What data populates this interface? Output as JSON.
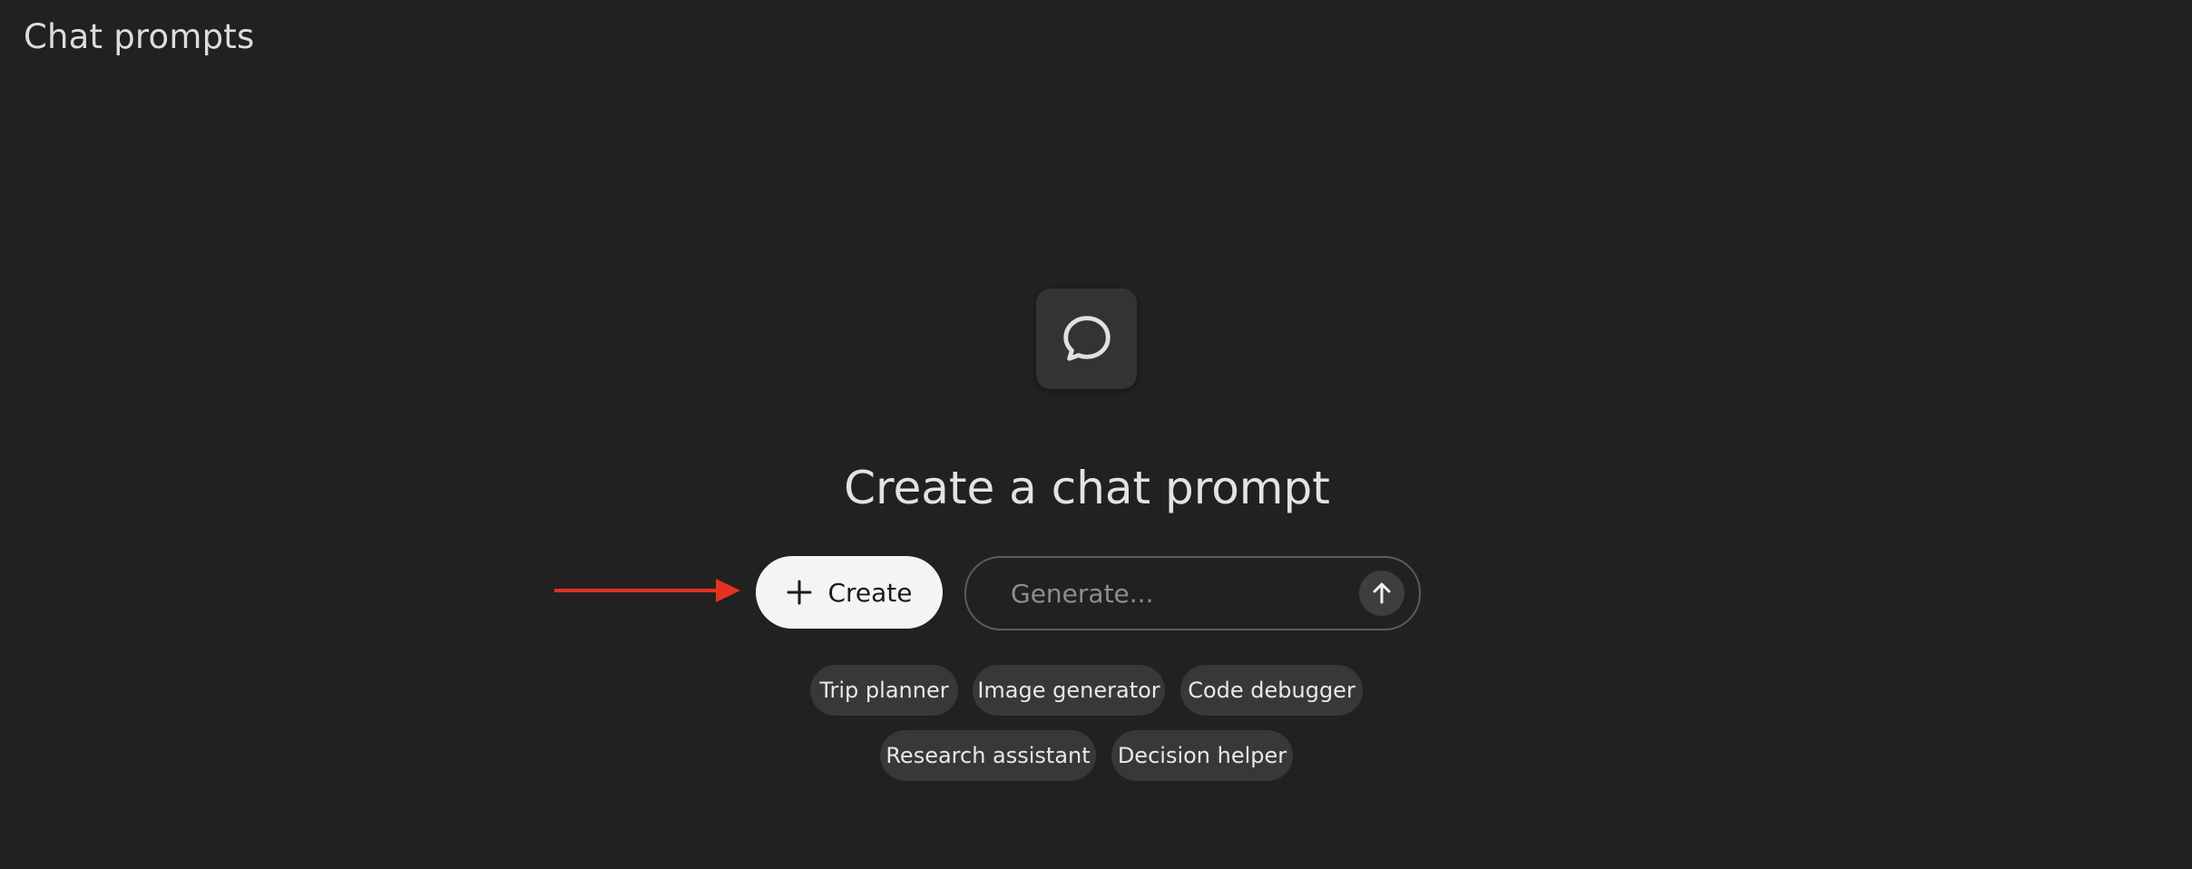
{
  "header": {
    "title": "Chat prompts"
  },
  "main": {
    "headline": "Create a chat prompt",
    "create_button_label": "Create",
    "generate": {
      "placeholder": "Generate...",
      "value": ""
    },
    "suggestions": [
      "Trip planner",
      "Image generator",
      "Code debugger",
      "Research assistant",
      "Decision helper"
    ]
  },
  "icons": {
    "tile": "chat-bubble-icon",
    "create": "plus-icon",
    "send": "arrow-up-icon",
    "annotation": "red-arrow-annotation"
  },
  "colors": {
    "background": "#212121",
    "tile": "#333333",
    "create_button": "#f4f4f4",
    "chip": "#383838",
    "annotation_arrow": "#e3321f"
  }
}
